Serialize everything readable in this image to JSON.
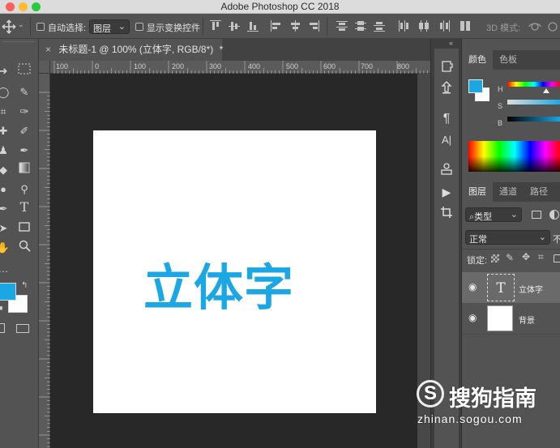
{
  "window": {
    "title": "Adobe Photoshop CC 2018",
    "traffic_colors": [
      "#fc5f57",
      "#fdbc2e",
      "#29c940"
    ]
  },
  "options_bar": {
    "auto_select_label": "自动选择:",
    "auto_select_value": "图层",
    "show_transform_label": "显示变换控件",
    "mode_3d_label": "3D 模式:"
  },
  "document_tab": {
    "label": "未标题-1 @ 100% (立体字, RGB/8*)",
    "close_glyph": "×",
    "unsaved_mark": "*"
  },
  "ruler": {
    "marks": [
      "100",
      "0",
      "100",
      "200",
      "300",
      "400",
      "500",
      "600",
      "700",
      "800"
    ]
  },
  "canvas": {
    "text": "立体字",
    "text_color": "#1ba7e4",
    "background": "#ffffff"
  },
  "color_panel": {
    "tabs": [
      "颜色",
      "色板"
    ],
    "foreground": "#1ba7e4",
    "background": "#ffffff",
    "labels": [
      "H",
      "S",
      "B"
    ]
  },
  "layers_panel": {
    "tabs": [
      "图层",
      "通道",
      "路径"
    ],
    "filter_label": "类型",
    "blend_mode": "正常",
    "opacity_label": "不",
    "lock_label": "锁定:",
    "layers": [
      {
        "name": "立体字",
        "type": "text",
        "thumb_glyph": "T"
      },
      {
        "name": "背景",
        "type": "background"
      }
    ]
  },
  "watermark": {
    "logo_text": "搜狗指南",
    "url": "zhinan.sogou.com"
  },
  "toolbar": {
    "foreground": "#1ba7e4",
    "background": "#ffffff"
  }
}
